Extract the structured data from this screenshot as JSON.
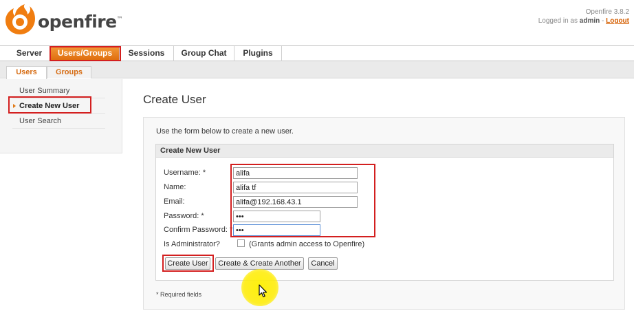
{
  "header": {
    "brand": "openfire",
    "trademark": "™",
    "version": "Openfire 3.8.2",
    "login_prefix": "Logged in as ",
    "user": "admin",
    "separator": " - ",
    "logout": "Logout"
  },
  "main_tabs": [
    "Server",
    "Users/Groups",
    "Sessions",
    "Group Chat",
    "Plugins"
  ],
  "active_main_tab": "Users/Groups",
  "sub_tabs": [
    "Users",
    "Groups"
  ],
  "active_sub_tab": "Users",
  "sidebar": {
    "items": [
      "User Summary",
      "Create New User",
      "User Search"
    ],
    "active": "Create New User"
  },
  "page": {
    "title": "Create User",
    "intro": "Use the form below to create a new user.",
    "form_title": "Create New User",
    "required_note": "* Required fields"
  },
  "form": {
    "username_label": "Username: *",
    "username_value": "alifa",
    "name_label": "Name:",
    "name_value": "alifa tf",
    "email_label": "Email:",
    "email_value": "alifa@192.168.43.1",
    "password_label": "Password: *",
    "password_value": "•••",
    "confirm_label": "Confirm Password: *",
    "confirm_value": "•••",
    "admin_label": "Is Administrator?",
    "admin_checked": false,
    "admin_hint": "(Grants admin access to Openfire)"
  },
  "buttons": {
    "create": "Create User",
    "create_another": "Create & Create Another",
    "cancel": "Cancel"
  },
  "colors": {
    "accent": "#de6a0b",
    "highlight": "#d31f1f",
    "cursor_glow": "#ffec00"
  }
}
